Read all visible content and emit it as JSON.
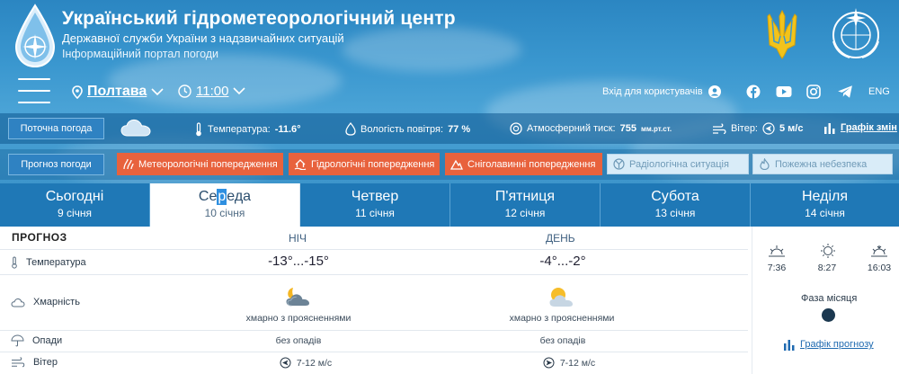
{
  "header": {
    "title": "Український гідрометеорологічний центр",
    "subtitle": "Державної служби України з надзвичайних ситуацій",
    "portal": "Інформаційний портал погоди"
  },
  "nav": {
    "city": "Полтава",
    "time": "11:00",
    "login": "Вхід для користувачів",
    "lang": "ENG"
  },
  "current": {
    "label": "Поточна погода",
    "temperature_label": "Температура:",
    "temperature_value": "-11.6°",
    "humidity_label": "Вологість повітря:",
    "humidity_value": "77 %",
    "pressure_label": "Атмосферний тиск:",
    "pressure_value": "755",
    "pressure_unit": "мм.рт.ст.",
    "wind_label": "Вітер:",
    "wind_value": "5 м/с",
    "changes_link": "Графік змін"
  },
  "forecast_bar": {
    "label": "Прогноз погоди",
    "warnings": [
      "Метеорологічні попередження",
      "Гідрологічні попередження",
      "Сніголавинні попередження",
      "Радіологічна ситуація",
      "Пожежна небезпека"
    ]
  },
  "tabs": [
    {
      "day": "Сьогодні",
      "date": "9 січня"
    },
    {
      "day_a": "Се",
      "day_b": "р",
      "day_c": "еда",
      "date": "10 січня"
    },
    {
      "day": "Четвер",
      "date": "11 січня"
    },
    {
      "day": "П'ятниця",
      "date": "12 січня"
    },
    {
      "day": "Субота",
      "date": "13 січня"
    },
    {
      "day": "Неділя",
      "date": "14 січня"
    }
  ],
  "table": {
    "heading": "ПРОГНОЗ",
    "night": "НІЧ",
    "day": "ДЕНЬ",
    "rows": {
      "temperature": {
        "label": "Температура",
        "night": "-13°...-15°",
        "day": "-4°...-2°"
      },
      "cloudiness": {
        "label": "Хмарність",
        "night": "хмарно з проясненнями",
        "day": "хмарно з проясненнями"
      },
      "precipitation": {
        "label": "Опади",
        "night": "без опадів",
        "day": "без опадів"
      },
      "wind": {
        "label": "Вітер",
        "night": "7-12 м/с",
        "day": "7-12 м/с"
      }
    }
  },
  "side": {
    "sunrise": "7:36",
    "daylength": "8:27",
    "sunset": "16:03",
    "moon_label": "Фаза місяця",
    "chart_link": "Графік прогнозу"
  }
}
